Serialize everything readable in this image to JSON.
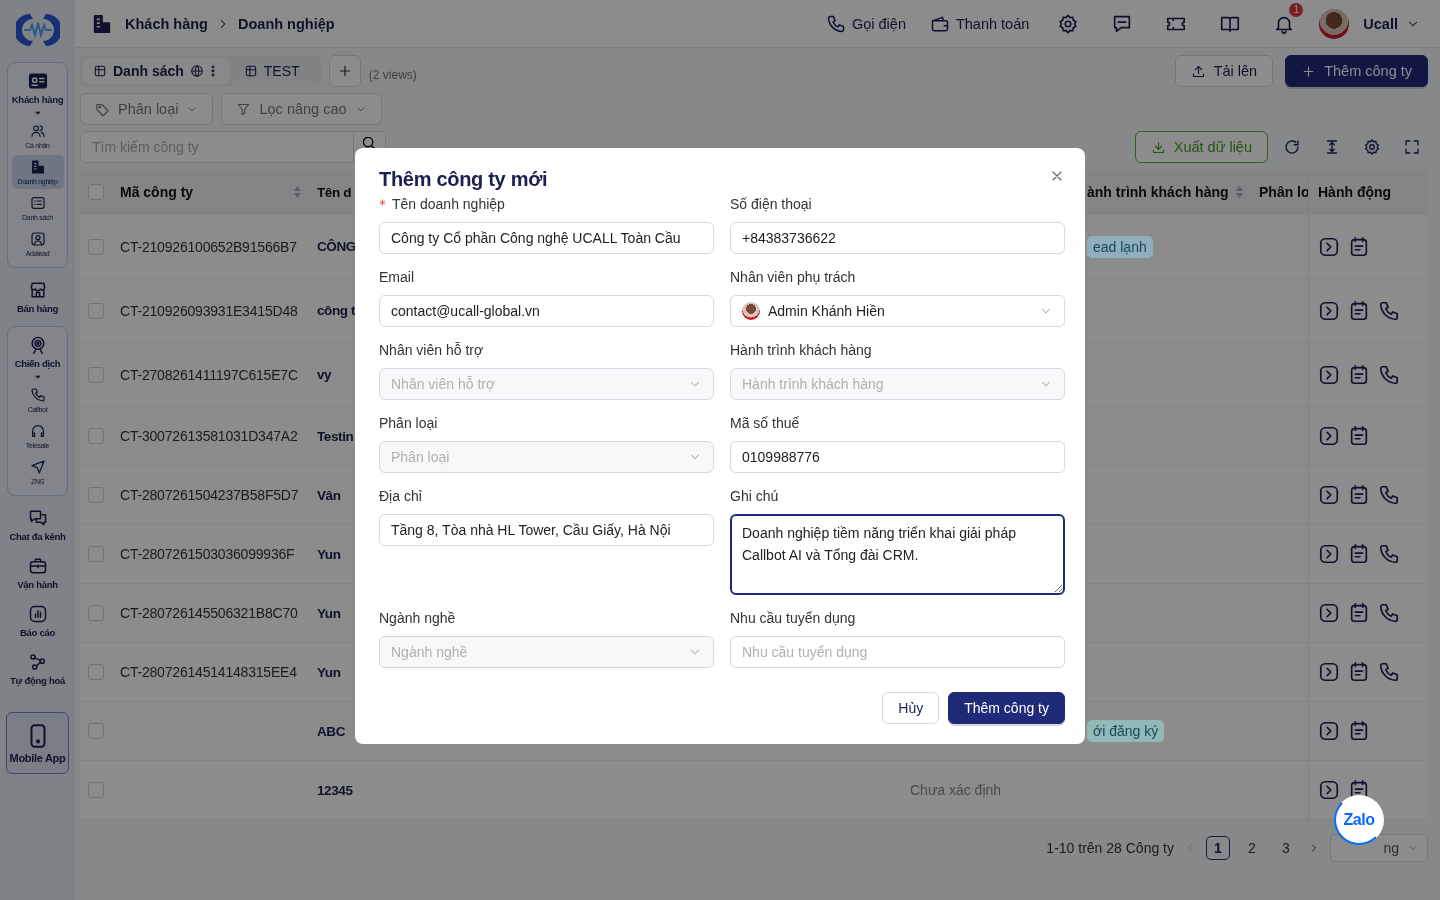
{
  "sidebar": {
    "items": [
      {
        "label": "Khách hàng",
        "kind": "group",
        "expanded": true,
        "children": [
          {
            "label": "Cá nhân",
            "selected": false
          },
          {
            "label": "Doanh nghiệp",
            "selected": true
          },
          {
            "label": "Danh sách",
            "selected": false
          },
          {
            "label": "Adalead",
            "selected": false
          }
        ]
      },
      {
        "label": "Bán hàng",
        "kind": "item"
      },
      {
        "label": "Chiến dịch",
        "kind": "group",
        "expanded": true,
        "children": [
          {
            "label": "Callbot",
            "selected": false
          },
          {
            "label": "Telesale",
            "selected": false
          },
          {
            "label": "ZNS",
            "selected": false
          }
        ]
      },
      {
        "label": "Chat đa kênh",
        "kind": "item"
      },
      {
        "label": "Vận hành",
        "kind": "item"
      },
      {
        "label": "Báo cáo",
        "kind": "item"
      },
      {
        "label": "Tự động hoá",
        "kind": "item"
      },
      {
        "label": "Mobile App",
        "kind": "app"
      }
    ]
  },
  "header": {
    "breadcrumb": [
      "Khách hàng",
      "Doanh nghiệp"
    ],
    "actions": [
      "Gọi điện",
      "Thanh toán"
    ],
    "notification_count": "1",
    "user": "Ucall"
  },
  "views": {
    "tabs": [
      {
        "label": "Danh sách",
        "selected": true
      },
      {
        "label": "TEST",
        "selected": false
      }
    ],
    "count": "(2 views)"
  },
  "buttons": {
    "upload": "Tải lên",
    "add": "Thêm công ty",
    "export": "Xuất dữ liệu"
  },
  "filters": [
    "Phân loại",
    "Lọc nâng cao"
  ],
  "search": {
    "placeholder": "Tìm kiếm công ty"
  },
  "table": {
    "header_checked": false,
    "columns": [
      "Mã công ty",
      "Tên d",
      "ành trình khách hàng",
      "Phân lo",
      "Hành động"
    ],
    "rows": [
      {
        "checked": false,
        "code": "CT-210926100652B91566B7",
        "name": "CÔNG",
        "journey": {
          "text": "ead lạnh",
          "color": "#8fb0bb"
        },
        "callable": false
      },
      {
        "checked": false,
        "code": "CT-210926093931E3415D48",
        "name": "công t",
        "callable": true
      },
      {
        "checked": false,
        "code": "CT-2708261411197C615E7C",
        "name": "vy",
        "callable": true
      },
      {
        "checked": false,
        "code": "CT-30072613581031D347A2",
        "name": "Testin",
        "callable": false
      },
      {
        "checked": false,
        "code": "CT-2807261504237B58F5D7",
        "name": "Vân",
        "callable": true
      },
      {
        "checked": false,
        "code": "CT-2807261503036099936F",
        "name": "Yun",
        "callable": true
      },
      {
        "checked": false,
        "code": "CT-280726145506321B8C70",
        "name": "Yun",
        "callable": true
      },
      {
        "checked": false,
        "code": "CT-28072614514148315EE4",
        "name": "Yun",
        "callable": true
      },
      {
        "checked": false,
        "name": "ABC",
        "journey": {
          "text": "ới đăng ký",
          "color": "#92b8b8"
        },
        "callable": false
      },
      {
        "checked": false,
        "name": "12345",
        "status": "Chưa xác định",
        "callable": false
      }
    ]
  },
  "pagination": {
    "summary": "1-10 trên 28 Công ty",
    "pages": [
      {
        "label": "1",
        "selected": true
      },
      {
        "label": "2",
        "selected": false
      },
      {
        "label": "3",
        "selected": false
      }
    ],
    "page_size": "ng"
  },
  "zalo": "Zalo",
  "modal": {
    "title": "Thêm công ty mới",
    "fields": [
      {
        "label": "Tên doanh nghiệp",
        "kind": "text",
        "required": true,
        "focused": false,
        "value": "Công ty Cổ phần Công nghệ UCALL Toàn Cầu"
      },
      {
        "label": "Số điện thoại",
        "kind": "text",
        "required": false,
        "focused": false,
        "value": "+84383736622"
      },
      {
        "label": "Email",
        "kind": "text",
        "required": false,
        "focused": false,
        "value": "contact@ucall-global.vn"
      },
      {
        "label": "Nhân viên phụ trách",
        "kind": "person",
        "required": false,
        "focused": false,
        "value": "Admin Khánh Hiền"
      },
      {
        "label": "Nhân viên hỗ trợ",
        "kind": "select",
        "required": false,
        "focused": false,
        "placeholder": "Nhân viên hỗ trợ"
      },
      {
        "label": "Hành trình khách hàng",
        "kind": "select",
        "required": false,
        "focused": false,
        "placeholder": "Hành trình khách hàng"
      },
      {
        "label": "Phân loại",
        "kind": "select",
        "required": false,
        "focused": false,
        "placeholder": "Phân loại"
      },
      {
        "label": "Mã số thuế",
        "kind": "text",
        "required": false,
        "focused": false,
        "value": "0109988776"
      },
      {
        "label": "Địa chỉ",
        "kind": "text",
        "required": false,
        "focused": false,
        "value": "Tầng 8, Tòa nhà HL Tower, Cầu Giấy, Hà Nội"
      },
      {
        "label": "Ghi chú",
        "kind": "textarea",
        "required": false,
        "focused": true,
        "value": "Doanh nghiệp tiềm năng triển khai giải pháp Callbot AI và Tổng đài CRM."
      },
      {
        "label": "Ngành nghề",
        "kind": "select",
        "required": false,
        "focused": false,
        "placeholder": "Ngành nghề"
      },
      {
        "label": "Nhu cầu tuyển dụng",
        "kind": "text",
        "required": false,
        "focused": false,
        "placeholder": "Nhu cầu tuyển dụng"
      }
    ],
    "cancel": "Hủy",
    "submit": "Thêm công ty"
  }
}
